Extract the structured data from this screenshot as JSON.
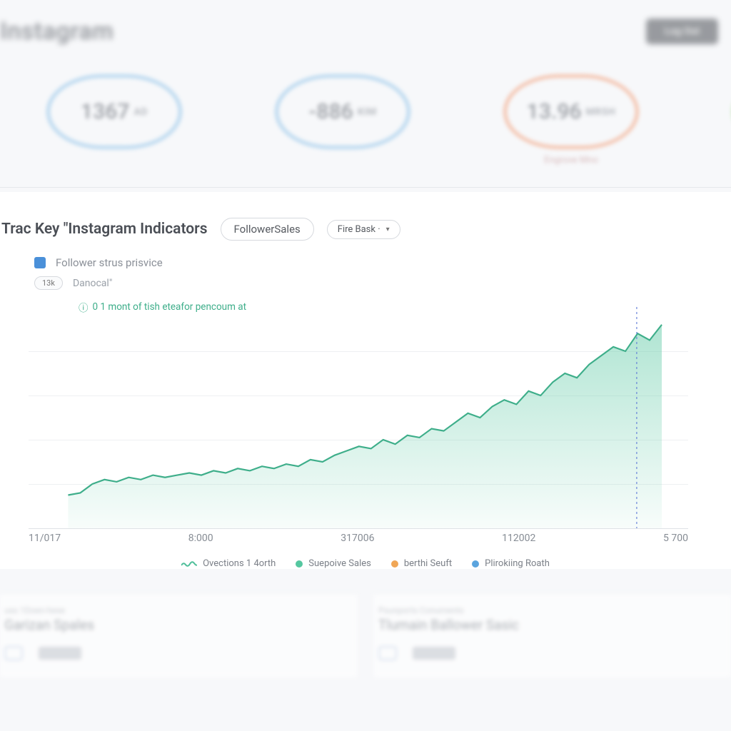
{
  "header": {
    "title": "Instagram",
    "button": "Log Out"
  },
  "kpis": [
    {
      "value": "1367",
      "unit": "AD",
      "ring": "blue",
      "sub": ""
    },
    {
      "value": "-886",
      "unit": "KIM",
      "ring": "blue",
      "sub": ""
    },
    {
      "value": "13.96",
      "unit": "MRSH",
      "ring": "orange",
      "sub": "Engrove Mno"
    },
    {
      "value": "",
      "unit": "",
      "ring": "green",
      "sub": ""
    }
  ],
  "chart": {
    "title": "Trac Key \"Instagram Indicators",
    "pill_main": "FollowerSales",
    "pill_drop": "Fire Bask ·",
    "sub_label": "Follower strus prisvice",
    "mini_pill": "13k",
    "sub_row_text": "Danocal\"",
    "annotation": "0  1 mont of tish eteafor pencoum at"
  },
  "x_ticks": [
    "11/017",
    "8:000",
    "317006",
    "112002",
    "5 700"
  ],
  "legend": [
    {
      "label": "Ovections 1 4orth",
      "kind": "squiggle",
      "color": "#4fbf9a"
    },
    {
      "label": "Suepoive Sales",
      "kind": "dot",
      "color": "#55c7a0"
    },
    {
      "label": "berthi Seuft",
      "kind": "dot",
      "color": "#f0a656"
    },
    {
      "label": "Plirokiing Roath",
      "kind": "dot",
      "color": "#5aa4de"
    }
  ],
  "bottom": [
    {
      "over": "uss 1Doen-hese",
      "title": "Garizan Spales"
    },
    {
      "over": "Psunports Conuments",
      "title": "Tlumain Ballower Sasic"
    }
  ],
  "chart_data": {
    "type": "area",
    "title": "Trac Key \"Instagram Indicators",
    "xlabel": "",
    "ylabel": "",
    "x_tick_labels": [
      "11/017",
      "8:000",
      "317006",
      "112002",
      "5 700"
    ],
    "ylim": [
      0,
      100
    ],
    "x": [
      0,
      2,
      4,
      6,
      8,
      10,
      12,
      14,
      16,
      18,
      20,
      22,
      24,
      26,
      28,
      30,
      32,
      34,
      36,
      38,
      40,
      42,
      44,
      46,
      48,
      50,
      52,
      54,
      56,
      58,
      60,
      62,
      64,
      66,
      68,
      70,
      72,
      74,
      76,
      78,
      80,
      82,
      84,
      86,
      88,
      90,
      92,
      94,
      96,
      98
    ],
    "series": [
      {
        "name": "Ovections 1 4orth",
        "color": "#4fbf9a",
        "values": [
          15,
          16,
          20,
          22,
          21,
          23,
          22,
          24,
          23,
          24,
          25,
          24,
          26,
          25,
          27,
          26,
          28,
          27,
          29,
          28,
          31,
          30,
          33,
          35,
          37,
          36,
          40,
          38,
          42,
          41,
          45,
          44,
          48,
          52,
          50,
          55,
          58,
          56,
          62,
          60,
          66,
          70,
          68,
          74,
          78,
          82,
          80,
          88,
          85,
          92
        ]
      }
    ],
    "annotations": [
      "0  1 mont of tish eteafor pencoum at"
    ],
    "legend_entries": [
      "Ovections 1 4orth",
      "Suepoive Sales",
      "berthi Seuft",
      "Plirokiing Roath"
    ]
  }
}
